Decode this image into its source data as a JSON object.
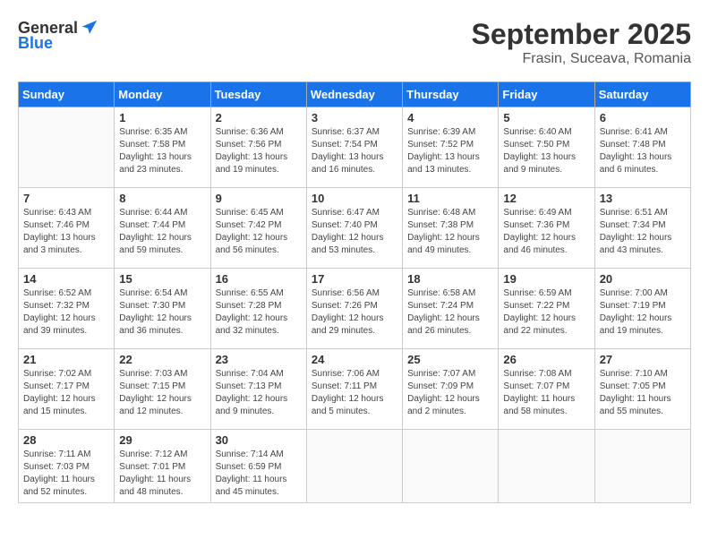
{
  "header": {
    "logo_general": "General",
    "logo_blue": "Blue",
    "month_year": "September 2025",
    "location": "Frasin, Suceava, Romania"
  },
  "weekdays": [
    "Sunday",
    "Monday",
    "Tuesday",
    "Wednesday",
    "Thursday",
    "Friday",
    "Saturday"
  ],
  "weeks": [
    [
      {
        "day": "",
        "info": ""
      },
      {
        "day": "1",
        "info": "Sunrise: 6:35 AM\nSunset: 7:58 PM\nDaylight: 13 hours\nand 23 minutes."
      },
      {
        "day": "2",
        "info": "Sunrise: 6:36 AM\nSunset: 7:56 PM\nDaylight: 13 hours\nand 19 minutes."
      },
      {
        "day": "3",
        "info": "Sunrise: 6:37 AM\nSunset: 7:54 PM\nDaylight: 13 hours\nand 16 minutes."
      },
      {
        "day": "4",
        "info": "Sunrise: 6:39 AM\nSunset: 7:52 PM\nDaylight: 13 hours\nand 13 minutes."
      },
      {
        "day": "5",
        "info": "Sunrise: 6:40 AM\nSunset: 7:50 PM\nDaylight: 13 hours\nand 9 minutes."
      },
      {
        "day": "6",
        "info": "Sunrise: 6:41 AM\nSunset: 7:48 PM\nDaylight: 13 hours\nand 6 minutes."
      }
    ],
    [
      {
        "day": "7",
        "info": "Sunrise: 6:43 AM\nSunset: 7:46 PM\nDaylight: 13 hours\nand 3 minutes."
      },
      {
        "day": "8",
        "info": "Sunrise: 6:44 AM\nSunset: 7:44 PM\nDaylight: 12 hours\nand 59 minutes."
      },
      {
        "day": "9",
        "info": "Sunrise: 6:45 AM\nSunset: 7:42 PM\nDaylight: 12 hours\nand 56 minutes."
      },
      {
        "day": "10",
        "info": "Sunrise: 6:47 AM\nSunset: 7:40 PM\nDaylight: 12 hours\nand 53 minutes."
      },
      {
        "day": "11",
        "info": "Sunrise: 6:48 AM\nSunset: 7:38 PM\nDaylight: 12 hours\nand 49 minutes."
      },
      {
        "day": "12",
        "info": "Sunrise: 6:49 AM\nSunset: 7:36 PM\nDaylight: 12 hours\nand 46 minutes."
      },
      {
        "day": "13",
        "info": "Sunrise: 6:51 AM\nSunset: 7:34 PM\nDaylight: 12 hours\nand 43 minutes."
      }
    ],
    [
      {
        "day": "14",
        "info": "Sunrise: 6:52 AM\nSunset: 7:32 PM\nDaylight: 12 hours\nand 39 minutes."
      },
      {
        "day": "15",
        "info": "Sunrise: 6:54 AM\nSunset: 7:30 PM\nDaylight: 12 hours\nand 36 minutes."
      },
      {
        "day": "16",
        "info": "Sunrise: 6:55 AM\nSunset: 7:28 PM\nDaylight: 12 hours\nand 32 minutes."
      },
      {
        "day": "17",
        "info": "Sunrise: 6:56 AM\nSunset: 7:26 PM\nDaylight: 12 hours\nand 29 minutes."
      },
      {
        "day": "18",
        "info": "Sunrise: 6:58 AM\nSunset: 7:24 PM\nDaylight: 12 hours\nand 26 minutes."
      },
      {
        "day": "19",
        "info": "Sunrise: 6:59 AM\nSunset: 7:22 PM\nDaylight: 12 hours\nand 22 minutes."
      },
      {
        "day": "20",
        "info": "Sunrise: 7:00 AM\nSunset: 7:19 PM\nDaylight: 12 hours\nand 19 minutes."
      }
    ],
    [
      {
        "day": "21",
        "info": "Sunrise: 7:02 AM\nSunset: 7:17 PM\nDaylight: 12 hours\nand 15 minutes."
      },
      {
        "day": "22",
        "info": "Sunrise: 7:03 AM\nSunset: 7:15 PM\nDaylight: 12 hours\nand 12 minutes."
      },
      {
        "day": "23",
        "info": "Sunrise: 7:04 AM\nSunset: 7:13 PM\nDaylight: 12 hours\nand 9 minutes."
      },
      {
        "day": "24",
        "info": "Sunrise: 7:06 AM\nSunset: 7:11 PM\nDaylight: 12 hours\nand 5 minutes."
      },
      {
        "day": "25",
        "info": "Sunrise: 7:07 AM\nSunset: 7:09 PM\nDaylight: 12 hours\nand 2 minutes."
      },
      {
        "day": "26",
        "info": "Sunrise: 7:08 AM\nSunset: 7:07 PM\nDaylight: 11 hours\nand 58 minutes."
      },
      {
        "day": "27",
        "info": "Sunrise: 7:10 AM\nSunset: 7:05 PM\nDaylight: 11 hours\nand 55 minutes."
      }
    ],
    [
      {
        "day": "28",
        "info": "Sunrise: 7:11 AM\nSunset: 7:03 PM\nDaylight: 11 hours\nand 52 minutes."
      },
      {
        "day": "29",
        "info": "Sunrise: 7:12 AM\nSunset: 7:01 PM\nDaylight: 11 hours\nand 48 minutes."
      },
      {
        "day": "30",
        "info": "Sunrise: 7:14 AM\nSunset: 6:59 PM\nDaylight: 11 hours\nand 45 minutes."
      },
      {
        "day": "",
        "info": ""
      },
      {
        "day": "",
        "info": ""
      },
      {
        "day": "",
        "info": ""
      },
      {
        "day": "",
        "info": ""
      }
    ]
  ]
}
